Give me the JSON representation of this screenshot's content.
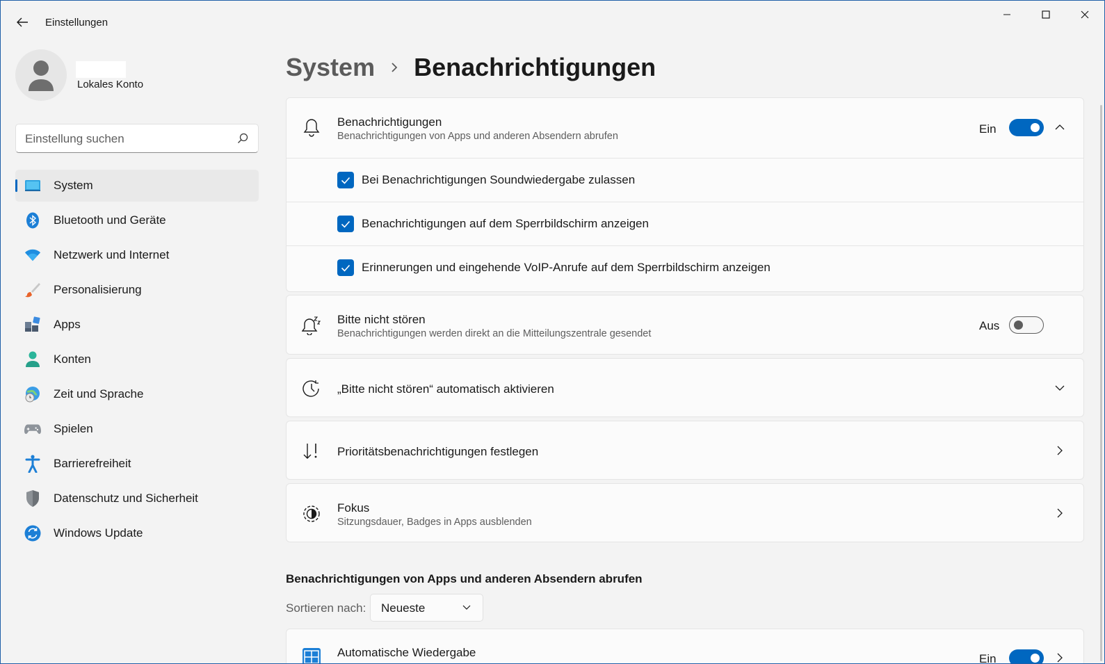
{
  "window": {
    "title": "Einstellungen"
  },
  "profile": {
    "account_type": "Lokales Konto"
  },
  "search": {
    "placeholder": "Einstellung suchen"
  },
  "sidebar": {
    "items": [
      {
        "label": "System",
        "icon": "system-icon",
        "active": true
      },
      {
        "label": "Bluetooth und Geräte",
        "icon": "bluetooth-icon"
      },
      {
        "label": "Netzwerk und Internet",
        "icon": "wifi-icon"
      },
      {
        "label": "Personalisierung",
        "icon": "brush-icon"
      },
      {
        "label": "Apps",
        "icon": "apps-icon"
      },
      {
        "label": "Konten",
        "icon": "person-icon"
      },
      {
        "label": "Zeit und Sprache",
        "icon": "globe-clock-icon"
      },
      {
        "label": "Spielen",
        "icon": "gamepad-icon"
      },
      {
        "label": "Barrierefreiheit",
        "icon": "accessibility-icon"
      },
      {
        "label": "Datenschutz und Sicherheit",
        "icon": "shield-icon"
      },
      {
        "label": "Windows Update",
        "icon": "update-icon"
      }
    ]
  },
  "breadcrumb": {
    "parent": "System",
    "current": "Benachrichtigungen"
  },
  "notifications": {
    "title": "Benachrichtigungen",
    "subtitle": "Benachrichtigungen von Apps und anderen Absendern abrufen",
    "state": "Ein",
    "checkboxes": [
      {
        "label": "Bei Benachrichtigungen Soundwiedergabe zulassen",
        "checked": true
      },
      {
        "label": "Benachrichtigungen auf dem Sperrbildschirm anzeigen",
        "checked": true
      },
      {
        "label": "Erinnerungen und eingehende VoIP-Anrufe auf dem Sperrbildschirm anzeigen",
        "checked": true
      }
    ]
  },
  "dnd": {
    "title": "Bitte nicht stören",
    "subtitle": "Benachrichtigungen werden direkt an die Mitteilungszentrale gesendet",
    "state": "Aus"
  },
  "auto_dnd": {
    "title": "„Bitte nicht stören“ automatisch aktivieren"
  },
  "priority": {
    "title": "Prioritätsbenachrichtigungen festlegen"
  },
  "focus": {
    "title": "Fokus",
    "subtitle": "Sitzungsdauer, Badges in Apps ausblenden"
  },
  "apps_section": {
    "heading": "Benachrichtigungen von Apps und anderen Absendern abrufen",
    "sort_label": "Sortieren nach:",
    "sort_value": "Neueste",
    "first_app": {
      "title": "Automatische Wiedergabe",
      "state": "Ein"
    }
  },
  "colors": {
    "accent": "#0067c0",
    "background": "#f3f3f3",
    "card": "#fbfbfb"
  }
}
